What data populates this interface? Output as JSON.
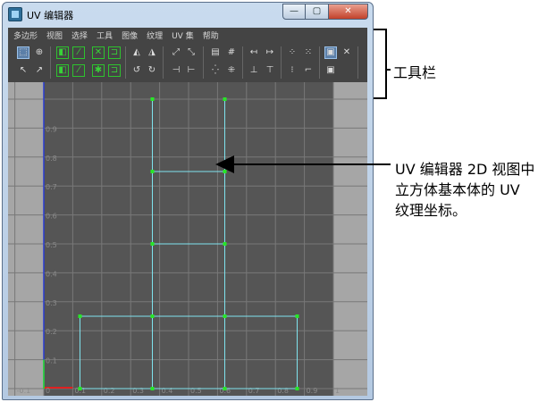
{
  "window": {
    "title": "UV 编辑器",
    "buttons": {
      "minimize": "—",
      "maximize": "▢",
      "close": "✕"
    }
  },
  "menu": [
    "多边形",
    "视图",
    "选择",
    "工具",
    "图像",
    "纹理",
    "UV 集",
    "帮助"
  ],
  "toolbar": {
    "row1": [
      "⬚",
      "⊕",
      "◧",
      "⁄",
      "✕",
      "⊐",
      "◭",
      "◮",
      "⤢",
      "⤡",
      "▤",
      "#",
      "↤",
      "↦",
      "⁘",
      "⁙",
      "▣",
      "✕"
    ],
    "row2": [
      "↖",
      "↗",
      "◧",
      "⁄",
      "✱",
      "⊐",
      "↺",
      "↻",
      "⊣",
      "⊢",
      "⁛",
      "⁜",
      "⊥",
      "⊤",
      "⁝",
      "⌐",
      "▣"
    ]
  },
  "viewport": {
    "y_ticks": [
      "0.9",
      "0.8",
      "0.7",
      "0.6",
      "0.5",
      "0.4",
      "0.3",
      "0.2",
      "0.1"
    ],
    "x_ticks": [
      "-0.1",
      "0",
      "0.1",
      "0.2",
      "0.3",
      "0.4",
      "0.5",
      "0.6",
      "0.7",
      "0.8",
      "0.9",
      "1"
    ],
    "uv_edges": [
      [
        [
          0.375,
          0.0
        ],
        [
          0.375,
          1.0
        ]
      ],
      [
        [
          0.625,
          0.0
        ],
        [
          0.625,
          1.0
        ]
      ],
      [
        [
          0.375,
          0.75
        ],
        [
          0.625,
          0.75
        ]
      ],
      [
        [
          0.375,
          0.5
        ],
        [
          0.625,
          0.5
        ]
      ],
      [
        [
          0.125,
          0.25
        ],
        [
          0.875,
          0.25
        ]
      ],
      [
        [
          0.125,
          0.0
        ],
        [
          0.875,
          0.0
        ]
      ],
      [
        [
          0.125,
          0.0
        ],
        [
          0.125,
          0.25
        ]
      ],
      [
        [
          0.875,
          0.0
        ],
        [
          0.875,
          0.25
        ]
      ]
    ],
    "uv_points": [
      [
        0.375,
        1.0
      ],
      [
        0.625,
        1.0
      ],
      [
        0.375,
        0.75
      ],
      [
        0.625,
        0.75
      ],
      [
        0.375,
        0.5
      ],
      [
        0.625,
        0.5
      ],
      [
        0.125,
        0.25
      ],
      [
        0.375,
        0.25
      ],
      [
        0.625,
        0.25
      ],
      [
        0.875,
        0.25
      ],
      [
        0.125,
        0.0
      ],
      [
        0.375,
        0.0
      ],
      [
        0.625,
        0.0
      ],
      [
        0.875,
        0.0
      ]
    ],
    "colors": {
      "background": "#555555",
      "outside": "#a6a6a6",
      "grid": "#787878",
      "edge": "#7fe3ee",
      "vertex": "#27e627",
      "u_axis": "#e02020",
      "v_axis": "#2a3cd0",
      "tick_label": "#8a8a8a"
    }
  },
  "callouts": {
    "toolbar_label": "工具栏",
    "description_line1": "UV 编辑器 2D 视图中",
    "description_line2": "立方体基本体的 UV",
    "description_line3": "纹理坐标。"
  }
}
